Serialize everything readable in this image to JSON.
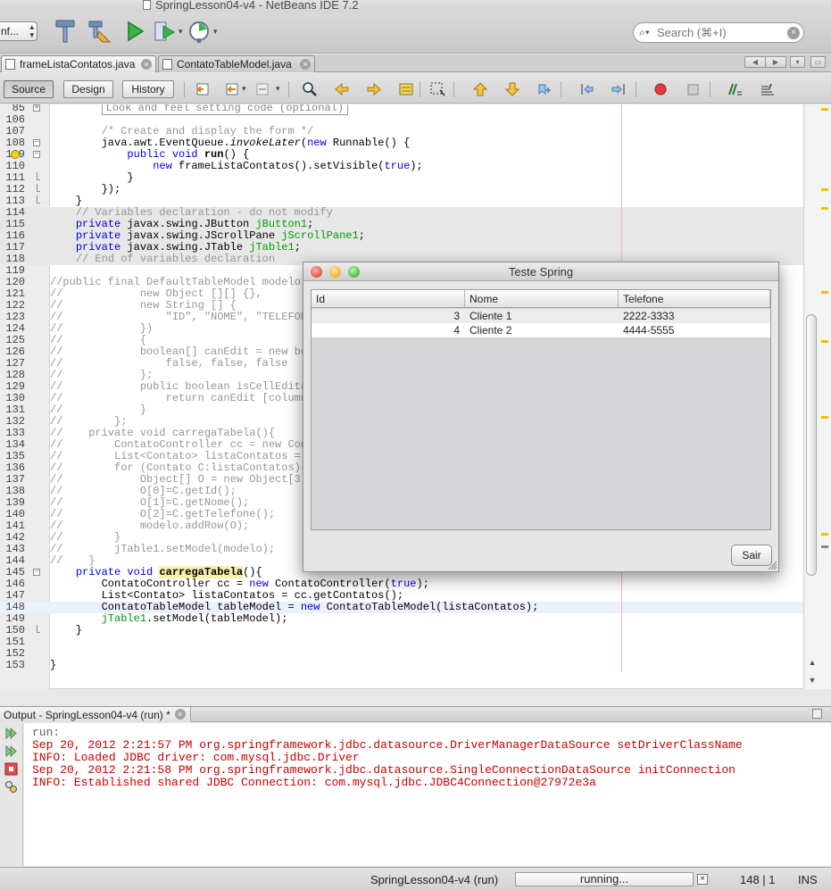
{
  "window": {
    "title": "SpringLesson04-v4 - NetBeans IDE 7.2"
  },
  "toolbar": {
    "config_value": "nf...",
    "search_placeholder": "Search (⌘+I)",
    "icons": [
      "build-hammer-icon",
      "clean-build-icon",
      "run-icon",
      "debug-icon",
      "profile-icon"
    ]
  },
  "editor_tabs": [
    {
      "label": "frameListaContatos.java",
      "active": true
    },
    {
      "label": "ContatoTableModel.java",
      "active": false
    }
  ],
  "view_buttons": {
    "source": "Source",
    "design": "Design",
    "history": "History"
  },
  "code": [
    {
      "n": "85",
      "fold": "plus",
      "html": "        <span class=\"boxed\">Look and feel setting code (optional)</span>"
    },
    {
      "n": "106",
      "html": ""
    },
    {
      "n": "107",
      "html": "        <span class=\"cm\">/* Create and display the form */</span>"
    },
    {
      "n": "108",
      "fold": "minus",
      "html": "        java.awt.EventQueue.<span class=\"it\">invokeLater</span>(<span class=\"k\">new</span> Runnable() {"
    },
    {
      "n": "109",
      "fold": "minus",
      "warn": true,
      "html": "            <span class=\"k\">public void</span> <b>run</b>() {"
    },
    {
      "n": "110",
      "html": "                <span class=\"k\">new</span> frameListaContatos().setVisible(<span class=\"k\">true</span>);"
    },
    {
      "n": "111",
      "fold": "end",
      "html": "            }"
    },
    {
      "n": "112",
      "fold": "end",
      "html": "        });"
    },
    {
      "n": "113",
      "fold": "end",
      "html": "    }"
    },
    {
      "n": "114",
      "guard": true,
      "html": "    <span class=\"cm\">// Variables declaration - do not modify</span>"
    },
    {
      "n": "115",
      "guard": true,
      "html": "    <span class=\"k\">private</span> javax.swing.JButton <span class=\"gf\">jButton1</span>;"
    },
    {
      "n": "116",
      "guard": true,
      "html": "    <span class=\"k\">private</span> javax.swing.JScrollPane <span class=\"gf\">jScrollPane1</span>;"
    },
    {
      "n": "117",
      "guard": true,
      "html": "    <span class=\"k\">private</span> javax.swing.JTable <span class=\"gf\">jTable1</span>;"
    },
    {
      "n": "118",
      "guard": true,
      "html": "    <span class=\"cm\">// End of variables declaration</span>"
    },
    {
      "n": "119",
      "html": ""
    },
    {
      "n": "120",
      "html": "<span class=\"cm\">//public final DefaultTableModel modelo = new DefaultTableModel(</span>"
    },
    {
      "n": "121",
      "html": "<span class=\"cm\">//            new Object [][] {},</span>"
    },
    {
      "n": "122",
      "html": "<span class=\"cm\">//            new String [] {</span>"
    },
    {
      "n": "123",
      "html": "<span class=\"cm\">//                \"ID\", \"NOME\", \"TELEFONE\"</span>"
    },
    {
      "n": "124",
      "html": "<span class=\"cm\">//            })</span>"
    },
    {
      "n": "125",
      "html": "<span class=\"cm\">//            {</span>"
    },
    {
      "n": "126",
      "html": "<span class=\"cm\">//            boolean[] canEdit = new boolean [] {</span>"
    },
    {
      "n": "127",
      "html": "<span class=\"cm\">//                false, false, false</span>"
    },
    {
      "n": "128",
      "html": "<span class=\"cm\">//            };</span>"
    },
    {
      "n": "129",
      "html": "<span class=\"cm\">//            public boolean isCellEditable(int rowIndex, int columnIndex) {</span>"
    },
    {
      "n": "130",
      "html": "<span class=\"cm\">//                return canEdit [columnIndex];</span>"
    },
    {
      "n": "131",
      "html": "<span class=\"cm\">//            }</span>"
    },
    {
      "n": "132",
      "html": "<span class=\"cm\">//        };</span>"
    },
    {
      "n": "133",
      "html": "<span class=\"cm\">//    private void carregaTabela(){</span>"
    },
    {
      "n": "134",
      "html": "<span class=\"cm\">//        ContatoController cc = new ContatoController();</span>"
    },
    {
      "n": "135",
      "html": "<span class=\"cm\">//        List&lt;Contato&gt; listaContatos = cc.getContatos();</span>"
    },
    {
      "n": "136",
      "html": "<span class=\"cm\">//        for (Contato C:listaContatos){</span>"
    },
    {
      "n": "137",
      "html": "<span class=\"cm\">//            Object[] O = new Object[3];</span>"
    },
    {
      "n": "138",
      "html": "<span class=\"cm\">//            O[0]=C.getId();</span>"
    },
    {
      "n": "139",
      "html": "<span class=\"cm\">//            O[1]=C.getNome();</span>"
    },
    {
      "n": "140",
      "html": "<span class=\"cm\">//            O[2]=C.getTelefone();</span>"
    },
    {
      "n": "141",
      "html": "<span class=\"cm\">//            modelo.addRow(O);</span>"
    },
    {
      "n": "142",
      "html": "<span class=\"cm\">//        }</span>"
    },
    {
      "n": "143",
      "html": "<span class=\"cm\">//        jTable1.setModel(modelo);</span>"
    },
    {
      "n": "144",
      "html": "<span class=\"cm\">//    }</span>"
    },
    {
      "n": "145",
      "fold": "minus",
      "html": "    <span class=\"k\">private void</span> <span class=\"hl\">carregaTabela</span>(){"
    },
    {
      "n": "146",
      "html": "        ContatoController cc = <span class=\"k\">new</span> ContatoController(<span class=\"k\">true</span>);"
    },
    {
      "n": "147",
      "html": "        List&lt;Contato&gt; listaContatos = cc.getContatos();"
    },
    {
      "n": "148",
      "current": true,
      "html": "        ContatoTableModel tableModel = <span class=\"k\">new</span> ContatoTableModel(listaContatos);"
    },
    {
      "n": "149",
      "html": "        <span class=\"gf\">jTable1</span>.setModel(tableModel);"
    },
    {
      "n": "150",
      "fold": "end",
      "html": "    }"
    },
    {
      "n": "151",
      "html": ""
    },
    {
      "n": "152",
      "html": ""
    },
    {
      "n": "153",
      "html": "}"
    }
  ],
  "app_window": {
    "title": "Teste Spring",
    "columns": [
      "Id",
      "Nome",
      "Telefone"
    ],
    "rows": [
      {
        "id": "3",
        "nome": "Cliente 1",
        "telefone": "2222-3333"
      },
      {
        "id": "4",
        "nome": "Cliente 2",
        "telefone": "4444-5555"
      }
    ],
    "button_label": "Sair"
  },
  "output": {
    "tab_label": "Output - SpringLesson04-v4 (run) *",
    "lines": [
      {
        "text": "run:",
        "style": "plain"
      },
      {
        "text": "Sep 20, 2012 2:21:57 PM org.springframework.jdbc.datasource.DriverManagerDataSource setDriverClassName",
        "style": "err"
      },
      {
        "text": "INFO: Loaded JDBC driver: com.mysql.jdbc.Driver",
        "style": "err"
      },
      {
        "text": "Sep 20, 2012 2:21:58 PM org.springframework.jdbc.datasource.SingleConnectionDataSource initConnection",
        "style": "err"
      },
      {
        "text": "INFO: Established shared JDBC Connection: com.mysql.jdbc.JDBC4Connection@27972e3a",
        "style": "err"
      }
    ]
  },
  "statusbar": {
    "task": "SpringLesson04-v4 (run)",
    "progress_text": "running...",
    "cancel_label": "×",
    "position": "148 | 1",
    "mode": "INS"
  },
  "colors": {
    "keyword": "#0000e6",
    "comment": "#969696",
    "guarded_field": "#009900",
    "output_error": "#c80000",
    "traffic_close": "#ee5b55",
    "traffic_min": "#f5bd3a",
    "traffic_max": "#5dc453"
  }
}
